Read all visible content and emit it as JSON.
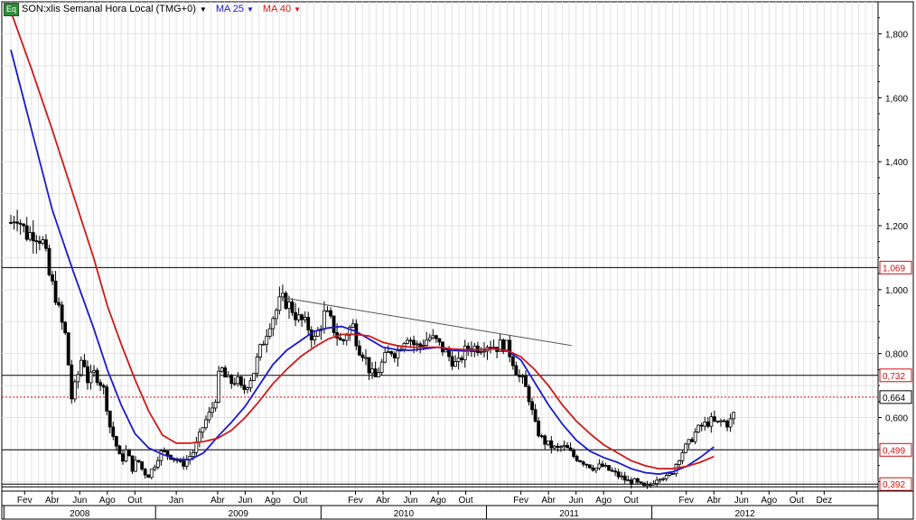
{
  "legend": {
    "badge": "Eq",
    "symbol": "SON:xlis Semanal Hora Local (TMG+0)",
    "ma25": "MA 25",
    "ma40": "MA 40"
  },
  "chart_data": {
    "type": "candlestick",
    "frequency": "weekly",
    "y_axis": {
      "side": "right",
      "range": [
        0.37,
        1.9
      ],
      "ticks": [
        "1,800",
        "1,600",
        "1,400",
        "1,200",
        "1,000",
        "0,800",
        "0,600"
      ],
      "tick_values": [
        1.8,
        1.6,
        1.4,
        1.2,
        1.0,
        0.8,
        0.6
      ]
    },
    "x_axis": {
      "months": [
        {
          "label": "Fev",
          "t": 1.0
        },
        {
          "label": "Abr",
          "t": 3.0
        },
        {
          "label": "Jun",
          "t": 5.0
        },
        {
          "label": "Ago",
          "t": 7.0
        },
        {
          "label": "Out",
          "t": 9.0
        },
        {
          "label": "Jan",
          "t": 12.0
        },
        {
          "label": "Abr",
          "t": 15.0
        },
        {
          "label": "Jun",
          "t": 17.0
        },
        {
          "label": "Ago",
          "t": 19.0
        },
        {
          "label": "Out",
          "t": 21.0
        },
        {
          "label": "Fev",
          "t": 25.0
        },
        {
          "label": "Abr",
          "t": 27.0
        },
        {
          "label": "Jun",
          "t": 29.0
        },
        {
          "label": "Ago",
          "t": 31.0
        },
        {
          "label": "Out",
          "t": 33.0
        },
        {
          "label": "Fev",
          "t": 37.0
        },
        {
          "label": "Abr",
          "t": 39.0
        },
        {
          "label": "Jun",
          "t": 41.0
        },
        {
          "label": "Ago",
          "t": 43.0
        },
        {
          "label": "Out",
          "t": 45.0
        },
        {
          "label": "Fev",
          "t": 49.0
        },
        {
          "label": "Abr",
          "t": 51.0
        },
        {
          "label": "Jun",
          "t": 53.0
        },
        {
          "label": "Ago",
          "t": 55.0
        },
        {
          "label": "Out",
          "t": 57.0
        },
        {
          "label": "Dez",
          "t": 59.0
        }
      ],
      "years": [
        {
          "label": "2008",
          "t_start": 0,
          "t_end": 11
        },
        {
          "label": "2009",
          "t_start": 11,
          "t_end": 23
        },
        {
          "label": "2010",
          "t_start": 23,
          "t_end": 35
        },
        {
          "label": "2011",
          "t_start": 35,
          "t_end": 47
        },
        {
          "label": "2012",
          "t_start": 47,
          "t_end": 60.5
        }
      ]
    },
    "horizontal_levels": [
      {
        "value": 1.069,
        "label": "1,069",
        "style": "solid"
      },
      {
        "value": 0.732,
        "label": "0,732",
        "style": "solid"
      },
      {
        "value": 0.664,
        "label": "0,664",
        "style": "dotted"
      },
      {
        "value": 0.499,
        "label": "0,499",
        "style": "solid"
      },
      {
        "value": 0.392,
        "label": "0,392",
        "style": "solid"
      }
    ],
    "last_price": "0,664",
    "trendline": {
      "from": {
        "t": 19.7,
        "v": 0.975
      },
      "to": {
        "t": 40.7,
        "v": 0.825
      }
    },
    "price_path": [
      [
        0.0,
        1.21
      ],
      [
        0.4,
        1.24
      ],
      [
        0.8,
        1.2
      ],
      [
        1.2,
        1.17
      ],
      [
        1.6,
        1.18
      ],
      [
        2.0,
        1.17
      ],
      [
        2.4,
        1.14
      ],
      [
        2.8,
        1.04
      ],
      [
        3.2,
        0.99
      ],
      [
        3.6,
        0.91
      ],
      [
        4.0,
        0.85
      ],
      [
        4.4,
        0.66
      ],
      [
        4.8,
        0.72
      ],
      [
        5.2,
        0.8
      ],
      [
        5.6,
        0.71
      ],
      [
        6.0,
        0.74
      ],
      [
        6.4,
        0.72
      ],
      [
        6.8,
        0.68
      ],
      [
        7.2,
        0.57
      ],
      [
        7.6,
        0.52
      ],
      [
        8.0,
        0.46
      ],
      [
        8.4,
        0.5
      ],
      [
        8.8,
        0.44
      ],
      [
        9.2,
        0.47
      ],
      [
        9.6,
        0.43
      ],
      [
        10.0,
        0.42
      ],
      [
        10.4,
        0.45
      ],
      [
        10.8,
        0.49
      ],
      [
        11.2,
        0.49
      ],
      [
        11.6,
        0.48
      ],
      [
        12.0,
        0.47
      ],
      [
        12.4,
        0.45
      ],
      [
        12.8,
        0.47
      ],
      [
        13.2,
        0.49
      ],
      [
        13.6,
        0.53
      ],
      [
        14.0,
        0.58
      ],
      [
        14.4,
        0.61
      ],
      [
        14.8,
        0.65
      ],
      [
        15.2,
        0.76
      ],
      [
        15.6,
        0.72
      ],
      [
        16.0,
        0.71
      ],
      [
        16.4,
        0.72
      ],
      [
        16.8,
        0.68
      ],
      [
        17.2,
        0.71
      ],
      [
        17.6,
        0.74
      ],
      [
        18.0,
        0.8
      ],
      [
        18.4,
        0.85
      ],
      [
        18.8,
        0.9
      ],
      [
        19.2,
        0.93
      ],
      [
        19.6,
        0.97
      ],
      [
        20.0,
        0.96
      ],
      [
        20.4,
        0.94
      ],
      [
        20.8,
        0.91
      ],
      [
        21.2,
        0.9
      ],
      [
        21.6,
        0.88
      ],
      [
        22.0,
        0.84
      ],
      [
        22.4,
        0.88
      ],
      [
        22.8,
        0.93
      ],
      [
        23.2,
        0.9
      ],
      [
        23.6,
        0.86
      ],
      [
        24.0,
        0.83
      ],
      [
        24.4,
        0.87
      ],
      [
        24.8,
        0.89
      ],
      [
        25.2,
        0.82
      ],
      [
        25.6,
        0.8
      ],
      [
        26.0,
        0.75
      ],
      [
        26.4,
        0.72
      ],
      [
        26.8,
        0.76
      ],
      [
        27.2,
        0.79
      ],
      [
        27.6,
        0.81
      ],
      [
        28.0,
        0.8
      ],
      [
        28.4,
        0.84
      ],
      [
        28.8,
        0.86
      ],
      [
        29.2,
        0.83
      ],
      [
        29.6,
        0.82
      ],
      [
        30.0,
        0.84
      ],
      [
        30.4,
        0.85
      ],
      [
        30.8,
        0.84
      ],
      [
        31.2,
        0.82
      ],
      [
        31.6,
        0.8
      ],
      [
        32.0,
        0.78
      ],
      [
        32.4,
        0.76
      ],
      [
        32.8,
        0.8
      ],
      [
        33.2,
        0.82
      ],
      [
        33.6,
        0.82
      ],
      [
        34.0,
        0.82
      ],
      [
        34.4,
        0.83
      ],
      [
        34.8,
        0.83
      ],
      [
        35.2,
        0.82
      ],
      [
        35.6,
        0.83
      ],
      [
        36.0,
        0.82
      ],
      [
        36.4,
        0.78
      ],
      [
        36.8,
        0.73
      ],
      [
        37.2,
        0.71
      ],
      [
        37.6,
        0.66
      ],
      [
        38.0,
        0.58
      ],
      [
        38.4,
        0.54
      ],
      [
        38.8,
        0.52
      ],
      [
        39.2,
        0.51
      ],
      [
        39.6,
        0.5
      ],
      [
        40.0,
        0.51
      ],
      [
        40.4,
        0.5
      ],
      [
        40.8,
        0.48
      ],
      [
        41.2,
        0.47
      ],
      [
        41.6,
        0.46
      ],
      [
        42.0,
        0.45
      ],
      [
        42.4,
        0.44
      ],
      [
        42.8,
        0.45
      ],
      [
        43.2,
        0.44
      ],
      [
        43.6,
        0.43
      ],
      [
        44.0,
        0.42
      ],
      [
        44.4,
        0.41
      ],
      [
        44.8,
        0.4
      ],
      [
        45.2,
        0.4
      ],
      [
        45.6,
        0.39
      ],
      [
        46.0,
        0.38
      ],
      [
        46.4,
        0.39
      ],
      [
        46.8,
        0.41
      ],
      [
        47.2,
        0.42
      ],
      [
        47.6,
        0.41
      ],
      [
        48.0,
        0.43
      ],
      [
        48.4,
        0.47
      ],
      [
        48.8,
        0.5
      ],
      [
        49.2,
        0.52
      ],
      [
        49.6,
        0.55
      ],
      [
        50.0,
        0.57
      ],
      [
        50.4,
        0.58
      ],
      [
        50.8,
        0.59
      ],
      [
        51.2,
        0.58
      ],
      [
        51.6,
        0.59
      ],
      [
        52.0,
        0.58
      ],
      [
        52.4,
        0.6
      ],
      [
        52.6,
        0.664
      ]
    ],
    "series": [
      {
        "name": "MA 25",
        "color": "#1a1acc",
        "points": [
          [
            0.0,
            1.75
          ],
          [
            1.5,
            1.5
          ],
          [
            3.0,
            1.25
          ],
          [
            4.5,
            1.06
          ],
          [
            6.0,
            0.88
          ],
          [
            7.0,
            0.75
          ],
          [
            8.0,
            0.64
          ],
          [
            9.0,
            0.55
          ],
          [
            10.0,
            0.505
          ],
          [
            11.0,
            0.485
          ],
          [
            12.0,
            0.47
          ],
          [
            13.0,
            0.468
          ],
          [
            14.0,
            0.49
          ],
          [
            15.0,
            0.54
          ],
          [
            16.0,
            0.585
          ],
          [
            17.0,
            0.635
          ],
          [
            18.0,
            0.7
          ],
          [
            19.0,
            0.765
          ],
          [
            20.0,
            0.81
          ],
          [
            21.0,
            0.84
          ],
          [
            22.0,
            0.87
          ],
          [
            23.0,
            0.88
          ],
          [
            24.0,
            0.885
          ],
          [
            25.0,
            0.87
          ],
          [
            26.0,
            0.845
          ],
          [
            27.0,
            0.82
          ],
          [
            28.0,
            0.812
          ],
          [
            29.0,
            0.81
          ],
          [
            30.0,
            0.815
          ],
          [
            31.0,
            0.82
          ],
          [
            32.0,
            0.81
          ],
          [
            33.0,
            0.808
          ],
          [
            34.0,
            0.812
          ],
          [
            35.0,
            0.815
          ],
          [
            36.0,
            0.81
          ],
          [
            37.0,
            0.78
          ],
          [
            38.0,
            0.71
          ],
          [
            39.0,
            0.64
          ],
          [
            40.0,
            0.58
          ],
          [
            41.0,
            0.53
          ],
          [
            42.0,
            0.495
          ],
          [
            43.0,
            0.475
          ],
          [
            44.0,
            0.46
          ],
          [
            45.0,
            0.44
          ],
          [
            46.0,
            0.428
          ],
          [
            47.0,
            0.423
          ],
          [
            48.0,
            0.43
          ],
          [
            49.0,
            0.447
          ],
          [
            50.0,
            0.475
          ],
          [
            51.0,
            0.508
          ]
        ]
      },
      {
        "name": "MA 40",
        "color": "#cc1a1a",
        "points": [
          [
            0.0,
            1.87
          ],
          [
            1.5,
            1.69
          ],
          [
            3.0,
            1.5
          ],
          [
            4.5,
            1.3
          ],
          [
            6.0,
            1.1
          ],
          [
            7.0,
            0.95
          ],
          [
            8.0,
            0.83
          ],
          [
            9.0,
            0.72
          ],
          [
            10.0,
            0.62
          ],
          [
            11.0,
            0.545
          ],
          [
            12.0,
            0.52
          ],
          [
            13.0,
            0.52
          ],
          [
            14.0,
            0.525
          ],
          [
            15.0,
            0.535
          ],
          [
            16.0,
            0.56
          ],
          [
            17.0,
            0.6
          ],
          [
            18.0,
            0.65
          ],
          [
            19.0,
            0.705
          ],
          [
            20.0,
            0.75
          ],
          [
            21.0,
            0.79
          ],
          [
            22.0,
            0.82
          ],
          [
            23.0,
            0.845
          ],
          [
            24.0,
            0.86
          ],
          [
            25.0,
            0.86
          ],
          [
            26.0,
            0.855
          ],
          [
            27.0,
            0.835
          ],
          [
            28.0,
            0.825
          ],
          [
            29.0,
            0.82
          ],
          [
            30.0,
            0.82
          ],
          [
            31.0,
            0.82
          ],
          [
            32.0,
            0.815
          ],
          [
            33.0,
            0.812
          ],
          [
            34.0,
            0.812
          ],
          [
            35.0,
            0.815
          ],
          [
            36.0,
            0.81
          ],
          [
            37.0,
            0.79
          ],
          [
            38.0,
            0.75
          ],
          [
            39.0,
            0.7
          ],
          [
            40.0,
            0.64
          ],
          [
            41.0,
            0.59
          ],
          [
            42.0,
            0.55
          ],
          [
            43.0,
            0.515
          ],
          [
            44.0,
            0.49
          ],
          [
            45.0,
            0.465
          ],
          [
            46.0,
            0.45
          ],
          [
            47.0,
            0.44
          ],
          [
            48.0,
            0.44
          ],
          [
            49.0,
            0.447
          ],
          [
            50.0,
            0.46
          ],
          [
            51.0,
            0.478
          ]
        ]
      }
    ]
  }
}
